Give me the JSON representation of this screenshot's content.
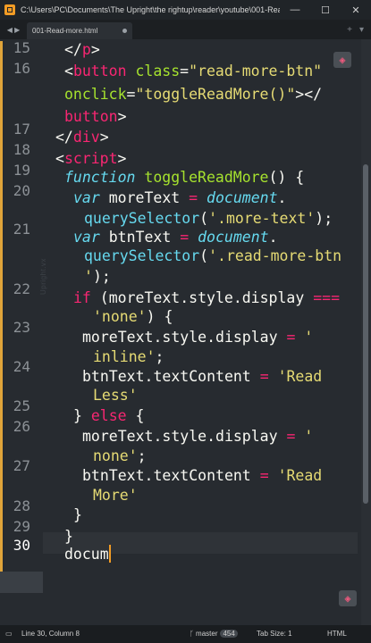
{
  "titlebar": {
    "path": "C:\\Users\\PC\\Documents\\The Upright\\the rightup\\reader\\youtube\\001-Rea...",
    "minimize": "—",
    "maximize": "☐",
    "close": "✕"
  },
  "tabbar": {
    "nav": "◀ ▶",
    "active_tab": "001-Read-more.html",
    "add": "+",
    "menu": "▾"
  },
  "gutter": {
    "lines": [
      "15",
      "16",
      "17",
      "18",
      "19",
      "20",
      "21",
      "22",
      "23",
      "24",
      "25",
      "26",
      "27",
      "28",
      "29",
      "30"
    ],
    "current": "30"
  },
  "code": [
    [
      [
        "t-punc",
        "</"
      ],
      [
        "t-tag",
        "p"
      ],
      [
        "t-punc",
        ">"
      ]
    ],
    [
      [
        "t-punc",
        "<"
      ],
      [
        "t-tag",
        "button"
      ],
      [
        "t-punc",
        " "
      ],
      [
        "t-attr",
        "class"
      ],
      [
        "t-punc",
        "="
      ],
      [
        "t-str",
        "\"read-more-btn\""
      ]
    ],
    [
      [
        "t-attr",
        "onclick"
      ],
      [
        "t-punc",
        "="
      ],
      [
        "t-str",
        "\"toggleReadMore()\""
      ],
      [
        "t-punc",
        "></"
      ]
    ],
    [
      [
        "t-tag",
        "button"
      ],
      [
        "t-punc",
        ">"
      ]
    ],
    [
      [
        "t-punc",
        "</"
      ],
      [
        "t-tag",
        "div"
      ],
      [
        "t-punc",
        ">"
      ]
    ],
    [
      [
        "t-punc",
        "<"
      ],
      [
        "t-tag",
        "script"
      ],
      [
        "t-punc",
        ">"
      ]
    ],
    [
      [
        "t-type",
        "function"
      ],
      [
        "t-punc",
        " "
      ],
      [
        "t-fn",
        "toggleReadMore"
      ],
      [
        "t-punc",
        "() {"
      ]
    ],
    [
      [
        "t-type",
        "var"
      ],
      [
        "t-punc",
        " moreText "
      ],
      [
        "t-op",
        "="
      ],
      [
        "t-punc",
        " "
      ],
      [
        "t-obj",
        "document"
      ],
      [
        "t-punc",
        "."
      ]
    ],
    [
      [
        "t-prop",
        "querySelector"
      ],
      [
        "t-punc",
        "("
      ],
      [
        "t-str",
        "'.more-text'"
      ],
      [
        "t-punc",
        ");"
      ]
    ],
    [
      [
        "t-type",
        "var"
      ],
      [
        "t-punc",
        " btnText "
      ],
      [
        "t-op",
        "="
      ],
      [
        "t-punc",
        " "
      ],
      [
        "t-obj",
        "document"
      ],
      [
        "t-punc",
        "."
      ]
    ],
    [
      [
        "t-prop",
        "querySelector"
      ],
      [
        "t-punc",
        "("
      ],
      [
        "t-str",
        "'.read-more-btn"
      ]
    ],
    [
      [
        "t-str",
        "'"
      ],
      [
        "t-punc",
        ");"
      ]
    ],
    [
      [
        "t-kw",
        "if"
      ],
      [
        "t-punc",
        " (moreText.style.display "
      ],
      [
        "t-op",
        "==="
      ]
    ],
    [
      [
        "t-str",
        "'none'"
      ],
      [
        "t-punc",
        ") {"
      ]
    ],
    [
      [
        "t-punc",
        "moreText.style.display "
      ],
      [
        "t-op",
        "="
      ],
      [
        "t-punc",
        " "
      ],
      [
        "t-str",
        "'"
      ]
    ],
    [
      [
        "t-str",
        "inline'"
      ],
      [
        "t-punc",
        ";"
      ]
    ],
    [
      [
        "t-punc",
        "btnText.textContent "
      ],
      [
        "t-op",
        "="
      ],
      [
        "t-punc",
        " "
      ],
      [
        "t-str",
        "'Read"
      ]
    ],
    [
      [
        "t-str",
        "Less'"
      ]
    ],
    [
      [
        "t-punc",
        "} "
      ],
      [
        "t-kw",
        "else"
      ],
      [
        "t-punc",
        " {"
      ]
    ],
    [
      [
        "t-punc",
        "moreText.style.display "
      ],
      [
        "t-op",
        "="
      ],
      [
        "t-punc",
        " "
      ],
      [
        "t-str",
        "'"
      ]
    ],
    [
      [
        "t-str",
        "none'"
      ],
      [
        "t-punc",
        ";"
      ]
    ],
    [
      [
        "t-punc",
        "btnText.textContent "
      ],
      [
        "t-op",
        "="
      ],
      [
        "t-punc",
        " "
      ],
      [
        "t-str",
        "'Read"
      ]
    ],
    [
      [
        "t-str",
        "More'"
      ]
    ],
    [
      [
        "t-punc",
        "}"
      ]
    ],
    [
      [
        "t-punc",
        "}"
      ]
    ],
    [
      [
        "t-punc",
        "docum"
      ]
    ]
  ],
  "watermark": "Upright.vx",
  "badge_icon": "shield-icon",
  "status": {
    "position": "Line 30, Column 8",
    "branch": "master",
    "branch_count": "454",
    "tab_size": "Tab Size: 1",
    "syntax": "HTML"
  }
}
